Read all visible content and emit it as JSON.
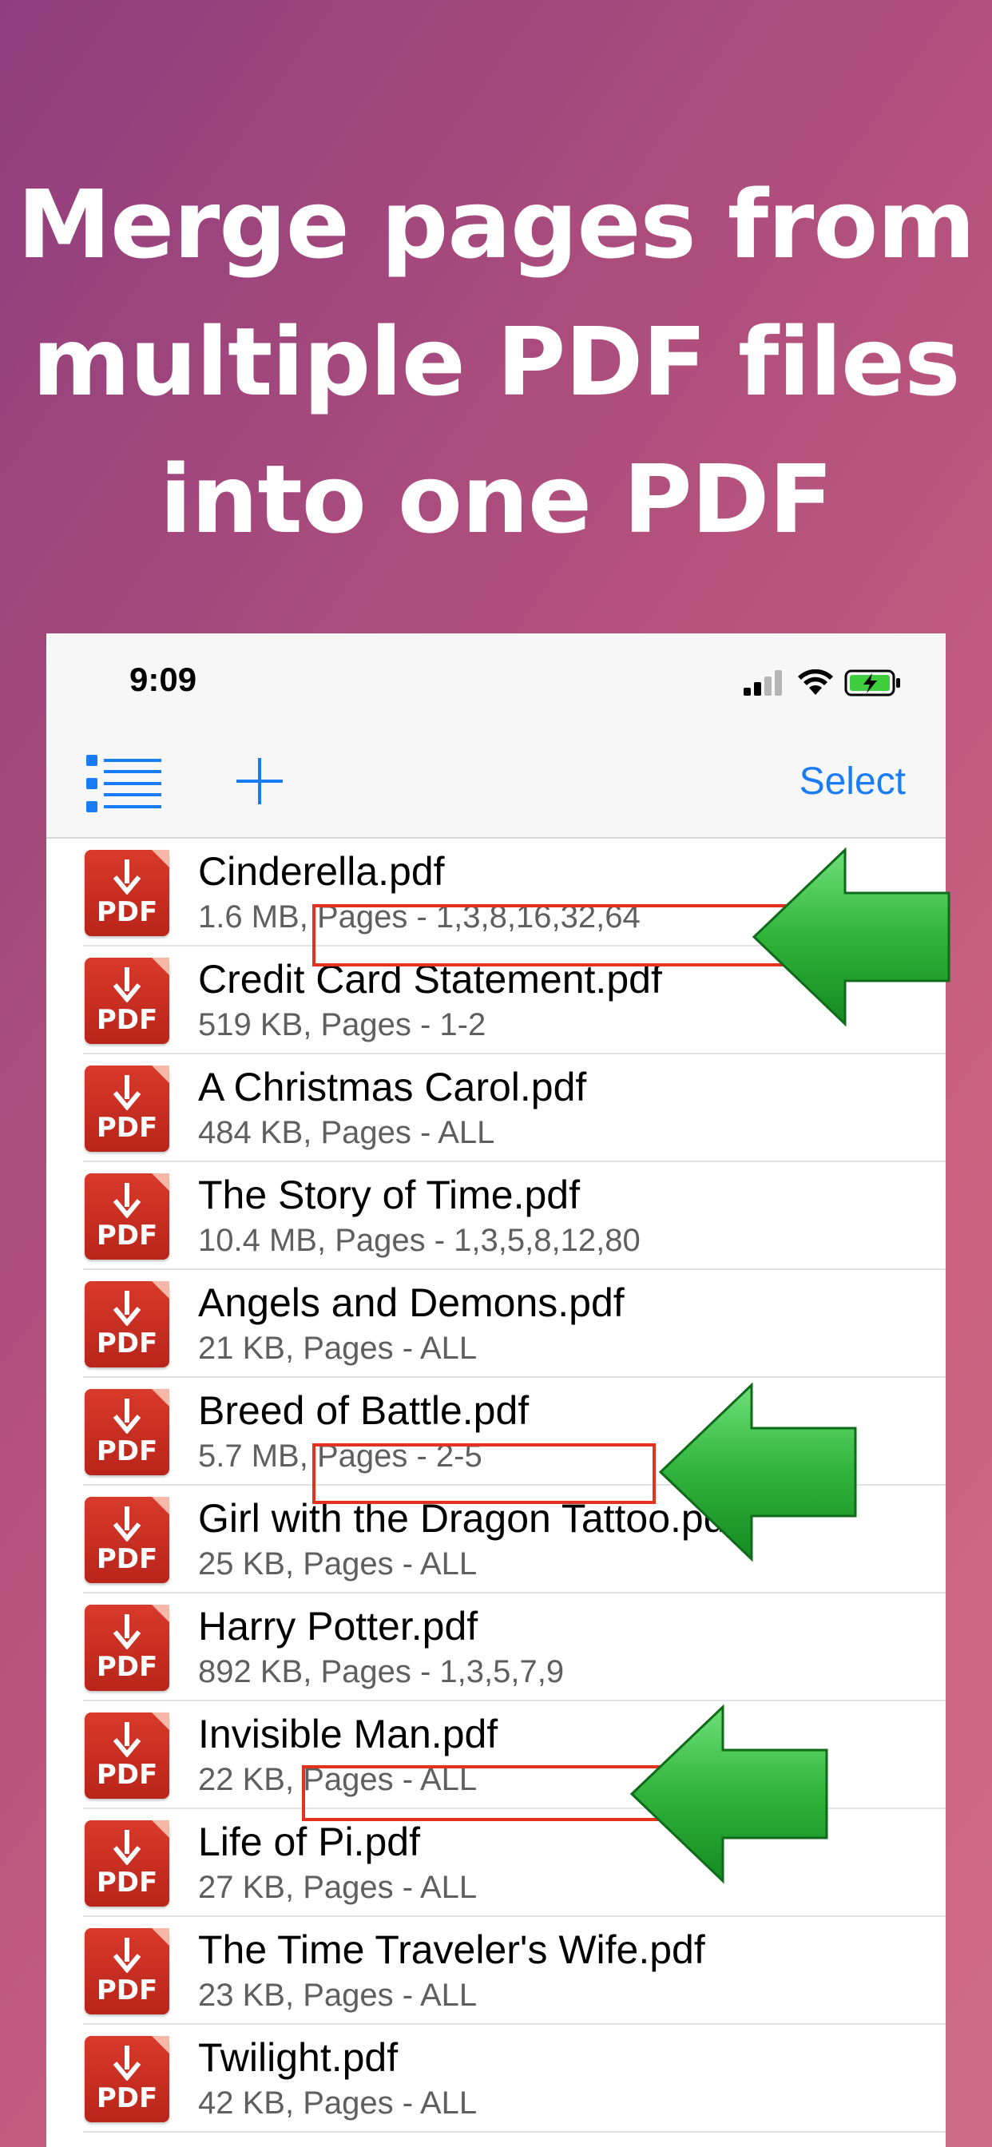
{
  "headline": {
    "line1": "Merge pages from",
    "line2": "multiple PDF files",
    "line3": "into one PDF"
  },
  "status_bar": {
    "time": "9:09"
  },
  "nav": {
    "select_label": "Select"
  },
  "icon_label": "PDF",
  "colors": {
    "accent": "#1a7cf4",
    "highlight_box": "#e3331f",
    "pdf_icon": "#c92d20",
    "arrow_green": "#2fb43a"
  },
  "files": [
    {
      "name": "Cinderella.pdf",
      "meta": "1.6 MB, Pages - 1,3,8,16,32,64",
      "highlighted": true
    },
    {
      "name": "Credit Card Statement.pdf",
      "meta": "519 KB, Pages - 1-2"
    },
    {
      "name": "A Christmas Carol.pdf",
      "meta": "484 KB, Pages - ALL"
    },
    {
      "name": "The Story of Time.pdf",
      "meta": "10.4 MB, Pages - 1,3,5,8,12,80"
    },
    {
      "name": "Angels and Demons.pdf",
      "meta": "21 KB, Pages - ALL"
    },
    {
      "name": "Breed of Battle.pdf",
      "meta": "5.7 MB, Pages - 2-5",
      "highlighted": true
    },
    {
      "name": "Girl with the Dragon Tattoo.pdf",
      "meta": "25 KB, Pages - ALL"
    },
    {
      "name": "Harry Potter.pdf",
      "meta": "892 KB, Pages - 1,3,5,7,9"
    },
    {
      "name": "Invisible Man.pdf",
      "meta": "22 KB, Pages - ALL",
      "highlighted": true
    },
    {
      "name": "Life of Pi.pdf",
      "meta": "27 KB, Pages - ALL"
    },
    {
      "name": "The Time Traveler's Wife.pdf",
      "meta": "23 KB, Pages - ALL"
    },
    {
      "name": "Twilight.pdf",
      "meta": "42 KB, Pages - ALL"
    }
  ]
}
